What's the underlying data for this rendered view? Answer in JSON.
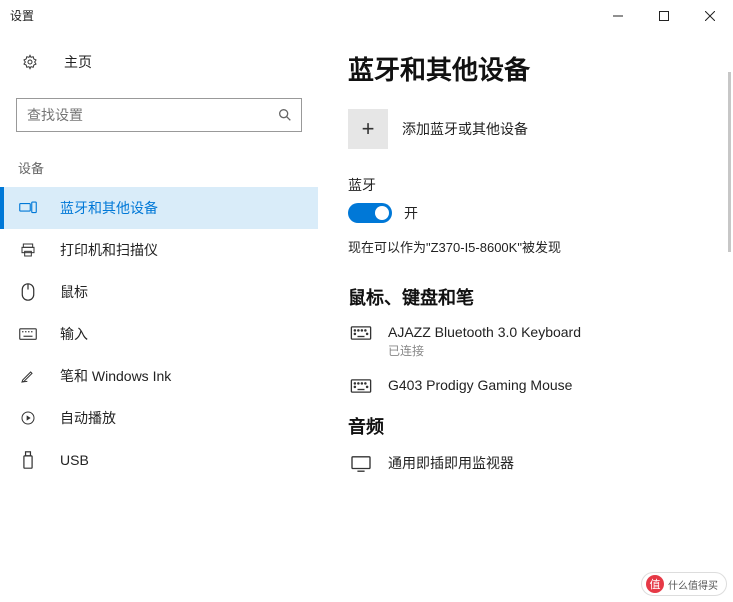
{
  "window": {
    "title": "设置"
  },
  "sidebar": {
    "home": "主页",
    "search_placeholder": "查找设置",
    "section": "设备",
    "items": [
      {
        "label": "蓝牙和其他设备"
      },
      {
        "label": "打印机和扫描仪"
      },
      {
        "label": "鼠标"
      },
      {
        "label": "输入"
      },
      {
        "label": "笔和 Windows Ink"
      },
      {
        "label": "自动播放"
      },
      {
        "label": "USB"
      }
    ]
  },
  "main": {
    "title": "蓝牙和其他设备",
    "add_label": "添加蓝牙或其他设备",
    "bt_heading": "蓝牙",
    "toggle_state": "开",
    "discover_text": "现在可以作为\"Z370-I5-8600K\"被发现",
    "cat1": "鼠标、键盘和笔",
    "devices": [
      {
        "name": "AJAZZ Bluetooth 3.0 Keyboard",
        "status": "已连接"
      },
      {
        "name": "G403 Prodigy Gaming Mouse",
        "status": ""
      }
    ],
    "cat2": "音频",
    "audio_devices": [
      {
        "name": "通用即插即用监视器"
      }
    ]
  },
  "watermark": "什么值得买"
}
